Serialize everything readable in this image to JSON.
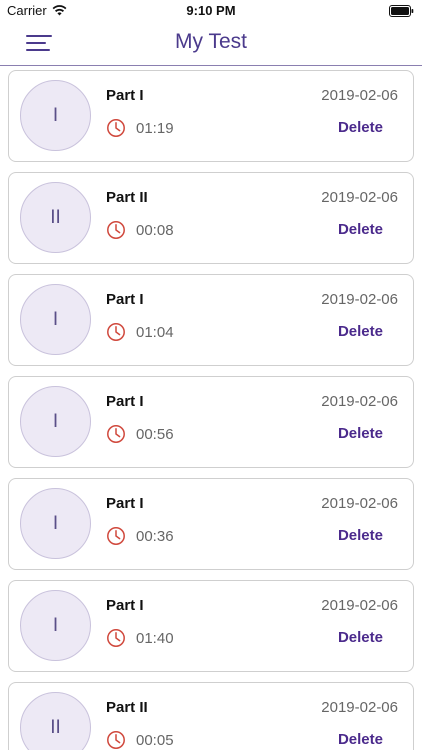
{
  "status": {
    "carrier": "Carrier",
    "time": "9:10 PM"
  },
  "header": {
    "title": "My Test"
  },
  "colors": {
    "accent": "#4b3a8c",
    "clock_icon": "#d0483c",
    "avatar_bg": "#ede9f5"
  },
  "recordings": [
    {
      "initial": "I",
      "title": "Part I",
      "date": "2019-02-06",
      "duration": "01:19",
      "delete_label": "Delete"
    },
    {
      "initial": "II",
      "title": "Part II",
      "date": "2019-02-06",
      "duration": "00:08",
      "delete_label": "Delete"
    },
    {
      "initial": "I",
      "title": "Part I",
      "date": "2019-02-06",
      "duration": "01:04",
      "delete_label": "Delete"
    },
    {
      "initial": "I",
      "title": "Part I",
      "date": "2019-02-06",
      "duration": "00:56",
      "delete_label": "Delete"
    },
    {
      "initial": "I",
      "title": "Part I",
      "date": "2019-02-06",
      "duration": "00:36",
      "delete_label": "Delete"
    },
    {
      "initial": "I",
      "title": "Part I",
      "date": "2019-02-06",
      "duration": "01:40",
      "delete_label": "Delete"
    },
    {
      "initial": "II",
      "title": "Part II",
      "date": "2019-02-06",
      "duration": "00:05",
      "delete_label": "Delete"
    }
  ]
}
